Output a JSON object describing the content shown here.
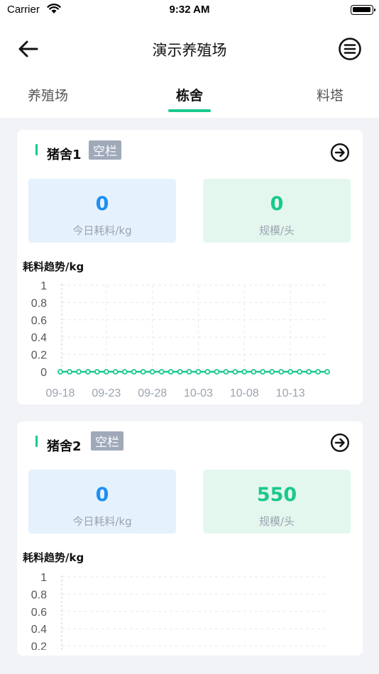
{
  "status_bar": {
    "carrier": "Carrier",
    "time": "9:32 AM"
  },
  "nav": {
    "title": "演示养殖场"
  },
  "tabs": [
    {
      "label": "养殖场",
      "active": false
    },
    {
      "label": "栋舍",
      "active": true
    },
    {
      "label": "料塔",
      "active": false
    }
  ],
  "colors": {
    "accent": "#19c98b",
    "blue": "#1f8ff0",
    "badge": "#9fa9b9"
  },
  "cards": [
    {
      "name": "猪舍1",
      "badge": "空栏",
      "stats": [
        {
          "value": "0",
          "label": "今日耗料/kg"
        },
        {
          "value": "0",
          "label": "规模/头"
        }
      ],
      "chart_title": "耗料趋势/kg"
    },
    {
      "name": "猪舍2",
      "badge": "空栏",
      "stats": [
        {
          "value": "0",
          "label": "今日耗料/kg"
        },
        {
          "value": "550",
          "label": "规模/头"
        }
      ],
      "chart_title": "耗料趋势/kg"
    }
  ],
  "chart_data": [
    {
      "type": "line",
      "title": "耗料趋势/kg",
      "xlabel": "",
      "ylabel": "",
      "ylim": [
        0,
        1
      ],
      "yticks": [
        "1",
        "0.8",
        "0.6",
        "0.4",
        "0.2",
        "0"
      ],
      "xtick_labels": [
        "09-18",
        "09-23",
        "09-28",
        "10-03",
        "10-08",
        "10-13"
      ],
      "x": [
        "09-18",
        "09-19",
        "09-20",
        "09-21",
        "09-22",
        "09-23",
        "09-24",
        "09-25",
        "09-26",
        "09-27",
        "09-28",
        "09-29",
        "09-30",
        "10-01",
        "10-02",
        "10-03",
        "10-04",
        "10-05",
        "10-06",
        "10-07",
        "10-08",
        "10-09",
        "10-10",
        "10-11",
        "10-12",
        "10-13",
        "10-14",
        "10-15",
        "10-16",
        "10-17"
      ],
      "series": [
        {
          "values": [
            0,
            0,
            0,
            0,
            0,
            0,
            0,
            0,
            0,
            0,
            0,
            0,
            0,
            0,
            0,
            0,
            0,
            0,
            0,
            0,
            0,
            0,
            0,
            0,
            0,
            0,
            0,
            0,
            0,
            0
          ]
        }
      ],
      "grid": true,
      "line_color": "#19c98b"
    },
    {
      "type": "line",
      "title": "耗料趋势/kg",
      "xlabel": "",
      "ylabel": "",
      "ylim": [
        0,
        1
      ],
      "yticks": [
        "1",
        "0.8",
        "0.6",
        "0.4",
        "0.2"
      ],
      "grid": true
    }
  ]
}
